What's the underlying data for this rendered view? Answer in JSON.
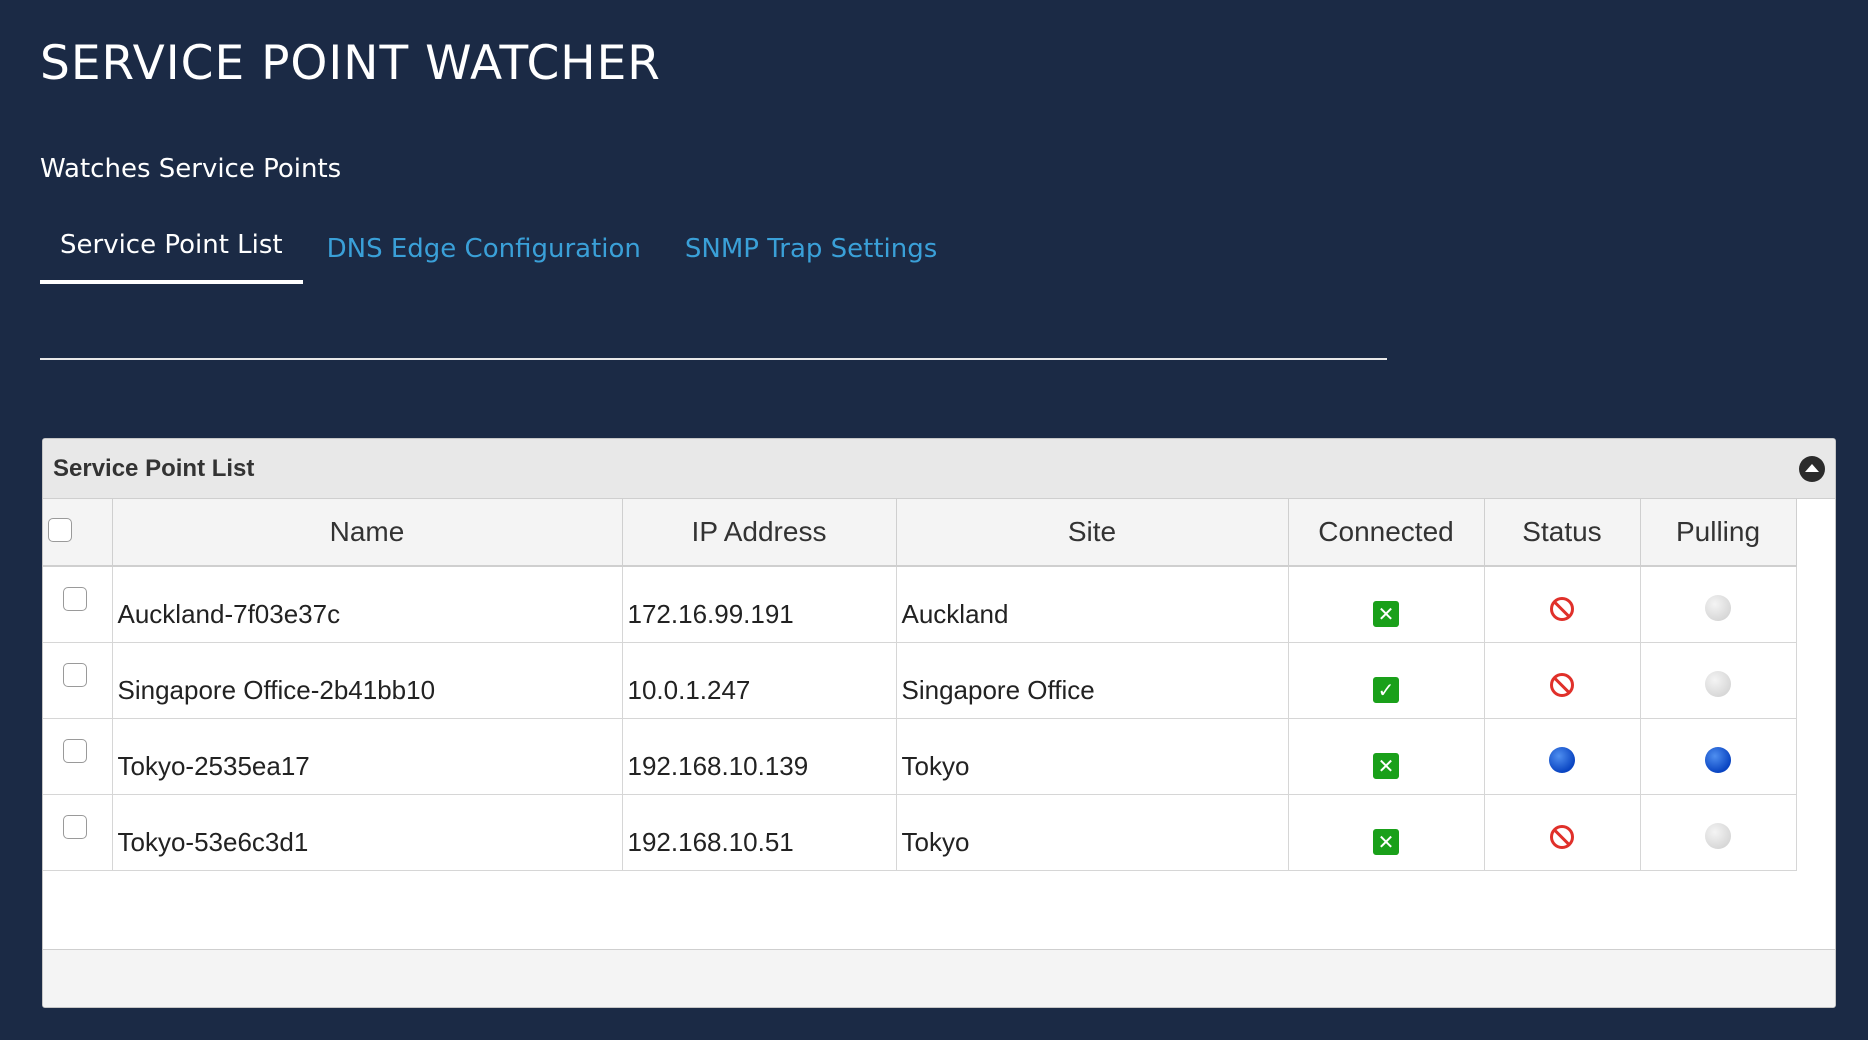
{
  "app": {
    "title": "SERVICE POINT WATCHER",
    "subtitle": "Watches Service Points"
  },
  "tabs": [
    {
      "label": "Service Point List",
      "active": true
    },
    {
      "label": "DNS Edge Configuration",
      "active": false
    },
    {
      "label": "SNMP Trap Settings",
      "active": false
    }
  ],
  "panel": {
    "title": "Service Point List",
    "collapse_icon": "chevron-up-circle-icon"
  },
  "table": {
    "columns": [
      "Name",
      "IP Address",
      "Site",
      "Connected",
      "Status",
      "Pulling"
    ],
    "rows": [
      {
        "name": "Auckland-7f03e37c",
        "ip": "172.16.99.191",
        "site": "Auckland",
        "connected": "x-icon",
        "status": "no-entry-icon",
        "pulling": "grey-dot-icon"
      },
      {
        "name": "Singapore Office-2b41bb10",
        "ip": "10.0.1.247",
        "site": "Singapore Office",
        "connected": "check-icon",
        "status": "no-entry-icon",
        "pulling": "grey-dot-icon"
      },
      {
        "name": "Tokyo-2535ea17",
        "ip": "192.168.10.139",
        "site": "Tokyo",
        "connected": "x-icon",
        "status": "blue-dot-icon",
        "pulling": "blue-dot-icon"
      },
      {
        "name": "Tokyo-53e6c3d1",
        "ip": "192.168.10.51",
        "site": "Tokyo",
        "connected": "x-icon",
        "status": "no-entry-icon",
        "pulling": "grey-dot-icon"
      }
    ]
  },
  "colors": {
    "background": "#1b2a45",
    "tab_link": "#3aa0d8",
    "success_green": "#1aa01a",
    "error_red": "#e0302a",
    "active_blue": "#0a45c2"
  }
}
